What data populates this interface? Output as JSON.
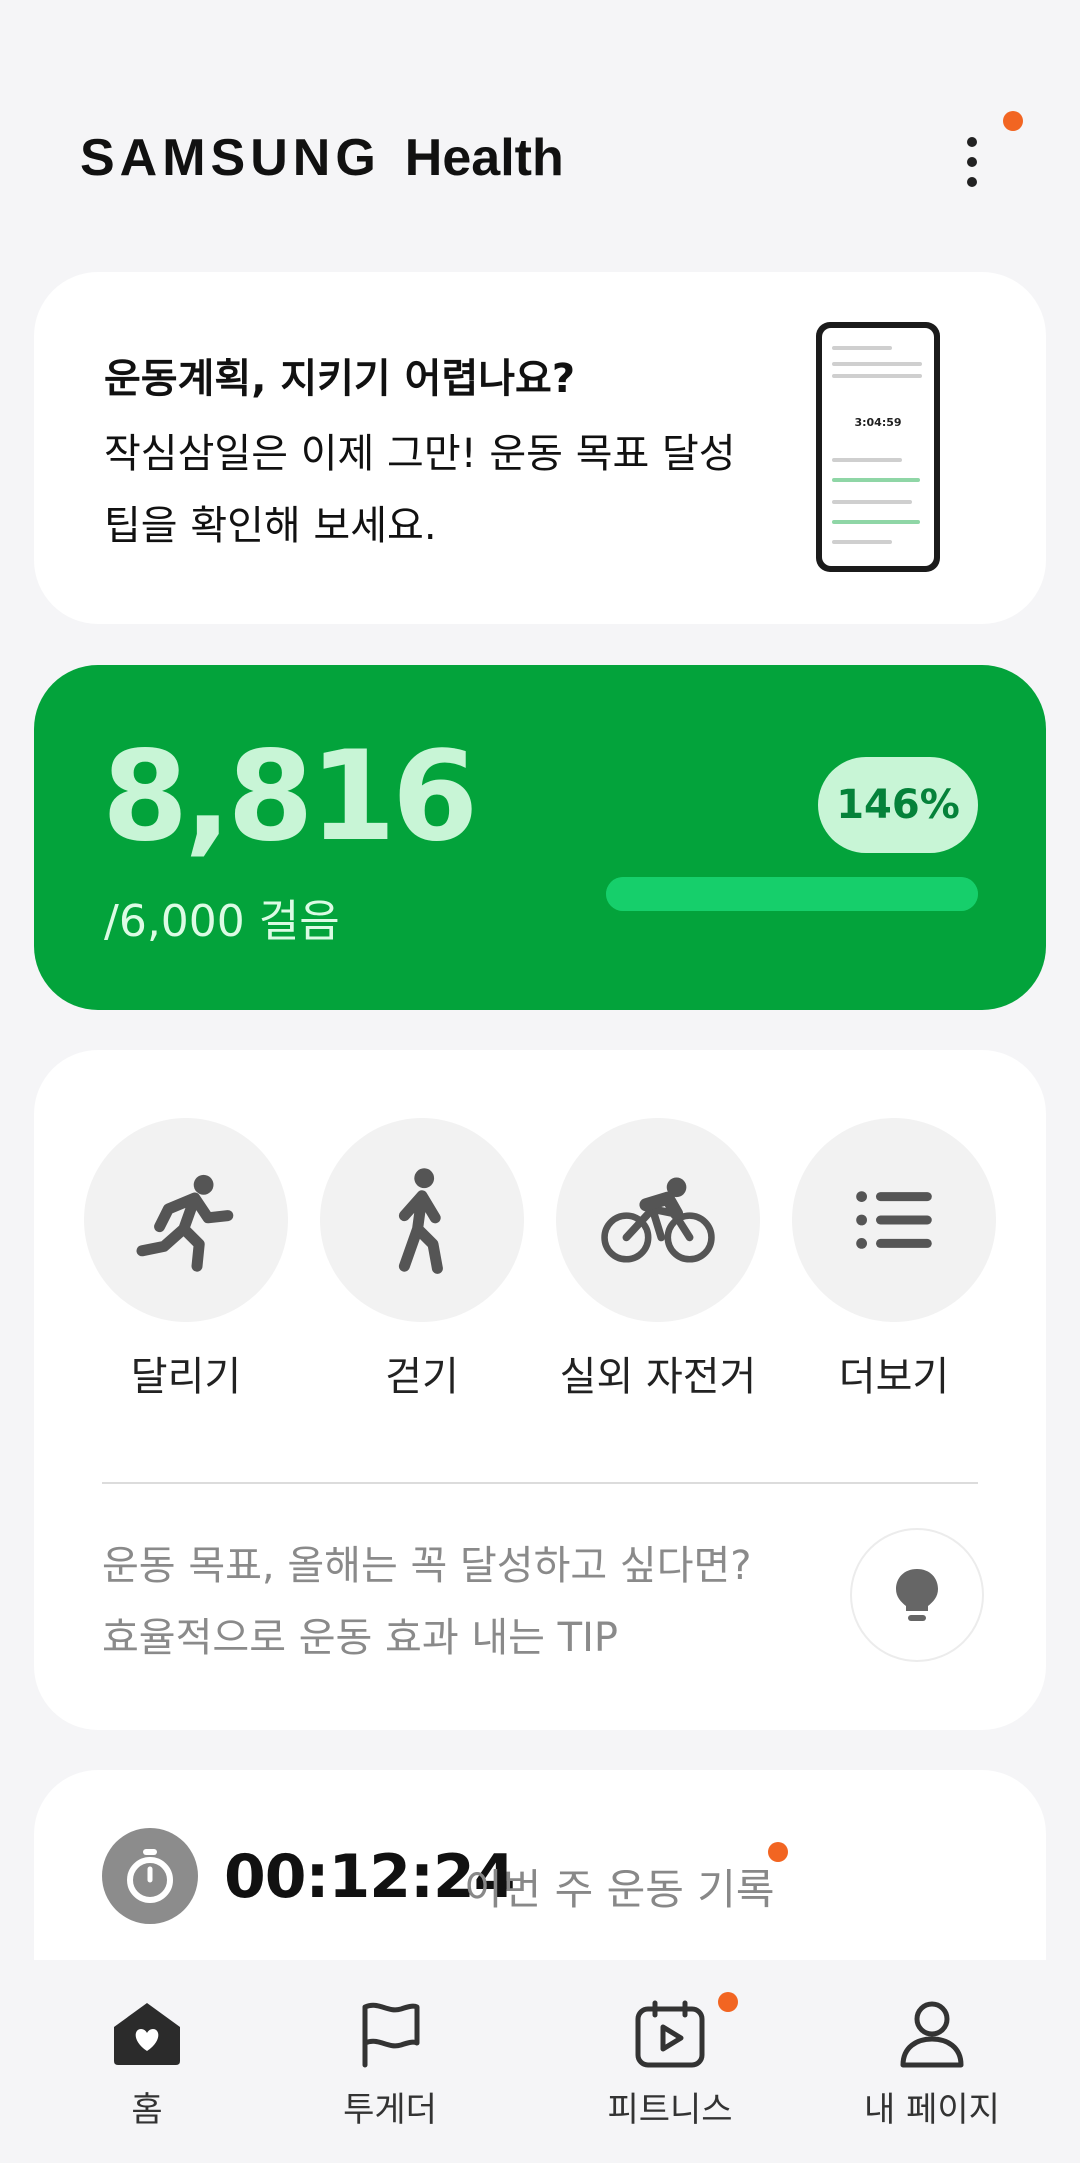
{
  "header": {
    "brand_primary": "SAMSUNG",
    "brand_secondary": "Health",
    "more_icon": "more-vertical-icon",
    "notification_color": "#f26522"
  },
  "promo": {
    "title": "운동계획, 지키기 어렵나요?",
    "body": "작심삼일은 이제 그만! 운동 목표 달성 팁을 확인해 보세요.",
    "image": "phone-screenshot-all-exercises",
    "phone_time": "3:04:59"
  },
  "steps": {
    "count": "8,816",
    "goal": "/6,000 걸음",
    "percent": "146%",
    "progress_fraction": 1.0,
    "accent_color": "#03a33b"
  },
  "exercises": {
    "items": [
      {
        "label": "달리기",
        "icon": "running-icon"
      },
      {
        "label": "걷기",
        "icon": "walking-icon"
      },
      {
        "label": "실외 자전거",
        "icon": "cycling-icon"
      },
      {
        "label": "더보기",
        "icon": "list-icon"
      }
    ],
    "tip_line1": "운동 목표, 올해는 꼭 달성하고 싶다면?",
    "tip_line2": "효율적으로 운동 효과 내는 TIP",
    "tip_icon": "lightbulb-icon"
  },
  "weekly": {
    "time": "00:12:24",
    "label": "이번 주 운동 기록",
    "icon": "stopwatch-icon"
  },
  "nav": {
    "items": [
      {
        "label": "홈",
        "icon": "home-heart-icon",
        "active": true
      },
      {
        "label": "투게더",
        "icon": "flag-icon",
        "active": false
      },
      {
        "label": "피트니스",
        "icon": "calendar-play-icon",
        "active": false
      },
      {
        "label": "내 페이지",
        "icon": "person-icon",
        "active": false
      }
    ]
  }
}
